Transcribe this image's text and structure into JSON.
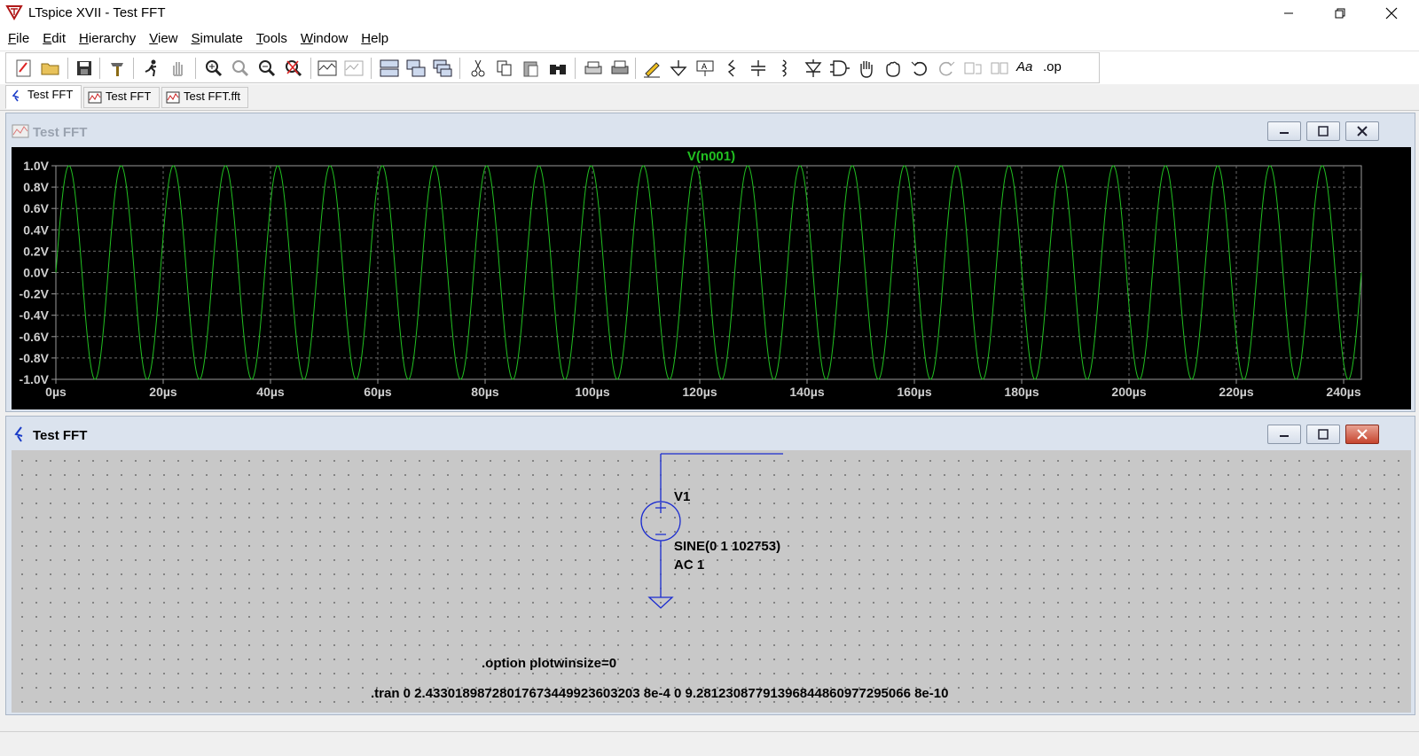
{
  "window": {
    "title": "LTspice XVII - Test FFT"
  },
  "menu": [
    {
      "key": "F",
      "rest": "ile"
    },
    {
      "key": "E",
      "rest": "dit"
    },
    {
      "key": "H",
      "rest": "ierarchy"
    },
    {
      "key": "V",
      "rest": "iew"
    },
    {
      "key": "S",
      "rest": "imulate"
    },
    {
      "key": "T",
      "rest": "ools"
    },
    {
      "key": "W",
      "rest": "indow"
    },
    {
      "key": "H",
      "rest": "elp"
    }
  ],
  "toolbar": {
    "font_label": "Aa",
    "op_label": ".op"
  },
  "tabs": [
    {
      "label": "Test FFT",
      "icon": "schematic-icon",
      "active": true
    },
    {
      "label": "Test FFT",
      "icon": "waveform-icon",
      "active": false
    },
    {
      "label": "Test FFT.fft",
      "icon": "waveform-icon",
      "active": false
    }
  ],
  "plot_window": {
    "title": "Test FFT"
  },
  "schematic_window": {
    "title": "Test FFT"
  },
  "chart_data": {
    "type": "line",
    "title": "V(n001)",
    "series": [
      {
        "name": "V(n001)",
        "function": "sine",
        "offset": 0,
        "amplitude": 1,
        "frequency_hz": 102753,
        "color": "#21c021"
      }
    ],
    "x_ticks": [
      "0µs",
      "20µs",
      "40µs",
      "60µs",
      "80µs",
      "100µs",
      "120µs",
      "140µs",
      "160µs",
      "180µs",
      "200µs",
      "220µs",
      "240µs"
    ],
    "y_ticks": [
      "1.0V",
      "0.8V",
      "0.6V",
      "0.4V",
      "0.2V",
      "0.0V",
      "-0.2V",
      "-0.4V",
      "-0.6V",
      "-0.8V",
      "-1.0V"
    ],
    "xlim_us": [
      0,
      243.301898728
    ],
    "ylim": [
      -1.0,
      1.0
    ],
    "grid": true,
    "background": "#000000"
  },
  "schematic": {
    "source_name": "V1",
    "source_value": "SINE(0 1 102753)",
    "source_ac": "AC 1",
    "directive_option": ".option plotwinsize=0",
    "directive_tran": ".tran 0 2.43301898728017673449923603203 8e-4 0 9.28123087791396844860977295066 8e-10"
  }
}
